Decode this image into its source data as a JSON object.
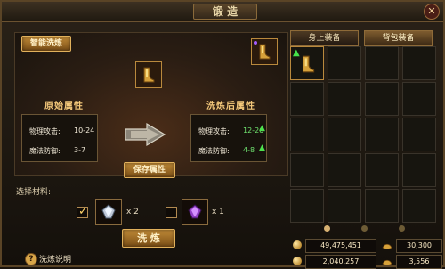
{
  "window": {
    "title": "锻 造",
    "close_symbol": "✕"
  },
  "left_panel": {
    "smart_refine_button": "智能洗炼",
    "original_attr_title": "原始属性",
    "refined_attr_title": "洗炼后属性",
    "save_button": "保存属性",
    "original_stats": [
      {
        "label": "物理攻击:",
        "value": "10-24"
      },
      {
        "label": "魔法防御:",
        "value": "3-7"
      }
    ],
    "refined_stats": [
      {
        "label": "物理攻击:",
        "value": "12-26"
      },
      {
        "label": "魔法防御:",
        "value": "4-8"
      }
    ],
    "refined_value_color": "#6ee06e",
    "material_title": "选择材料:",
    "materials": [
      {
        "checked": true,
        "quantity": "x 2",
        "icon": "silver-gem-icon"
      },
      {
        "checked": false,
        "quantity": "x 1",
        "icon": "purple-gem-icon"
      }
    ],
    "refine_button": "洗 炼",
    "help_symbol": "?",
    "help_label": "洗炼说明"
  },
  "right_panel": {
    "tabs": [
      {
        "label": "身上装备",
        "active": false
      },
      {
        "label": "背包装备",
        "active": true
      }
    ],
    "page_dots": 3
  },
  "currency": {
    "row1_left": "49,475,451",
    "row1_right": "30,300",
    "row2_left": "2,040,257",
    "row2_right": "3,556"
  }
}
